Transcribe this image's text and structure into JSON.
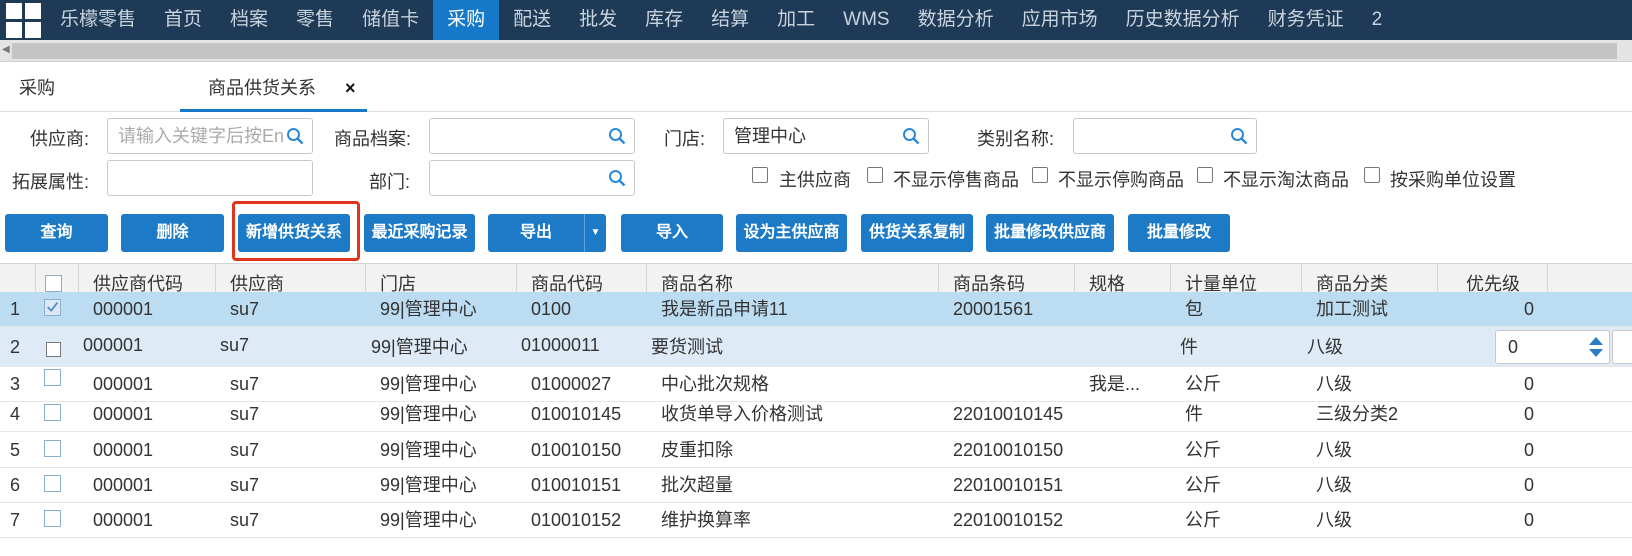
{
  "nav": {
    "brand": "乐檬零售",
    "items": [
      "首页",
      "档案",
      "零售",
      "储值卡",
      "采购",
      "配送",
      "批发",
      "库存",
      "结算",
      "加工",
      "WMS",
      "数据分析",
      "应用市场",
      "历史数据分析",
      "财务凭证",
      "2"
    ],
    "active": "采购"
  },
  "tabs": {
    "tab1": "采购",
    "tab2": "商品供货关系",
    "close": "×"
  },
  "filters": {
    "supplier_label": "供应商:",
    "supplier_placeholder": "请输入关键字后按En",
    "product_label": "商品档案:",
    "product_value": "",
    "store_label": "门店:",
    "store_value": "管理中心",
    "category_label": "类别名称:",
    "category_value": "",
    "ext_label": "拓展属性:",
    "ext_value": "",
    "dept_label": "部门:",
    "dept_value": "",
    "checkboxes": [
      "主供应商",
      "不显示停售商品",
      "不显示停购商品",
      "不显示淘汰商品",
      "按采购单位设置"
    ]
  },
  "buttons": {
    "query": "查询",
    "delete": "删除",
    "add_relation": "新增供货关系",
    "recent_purchase": "最近采购记录",
    "export": "导出",
    "import": "导入",
    "set_main": "设为主供应商",
    "copy_relation": "供货关系复制",
    "batch_supplier": "批量修改供应商",
    "batch_modify": "批量修改"
  },
  "table": {
    "headers": [
      "供应商代码",
      "供应商",
      "门店",
      "商品代码",
      "商品名称",
      "商品条码",
      "规格",
      "计量单位",
      "商品分类",
      "优先级"
    ],
    "rows": [
      {
        "no": "1",
        "code": "000001",
        "supplier": "su7",
        "store": "99|管理中心",
        "pcode": "0100",
        "pname": "我是新品申请11",
        "barcode": "20001561",
        "spec": "",
        "unit": "包",
        "cat": "加工测试",
        "prio": "0"
      },
      {
        "no": "2",
        "code": "000001",
        "supplier": "su7",
        "store": "99|管理中心",
        "pcode": "01000011",
        "pname": "要货测试",
        "barcode": "",
        "spec": "",
        "unit": "件",
        "cat": "八级",
        "prio": "0"
      },
      {
        "no": "3",
        "code": "000001",
        "supplier": "su7",
        "store": "99|管理中心",
        "pcode": "01000027",
        "pname": "中心批次规格",
        "barcode": "",
        "spec": "我是...",
        "unit": "公斤",
        "cat": "八级",
        "prio": "0"
      },
      {
        "no": "4",
        "code": "000001",
        "supplier": "su7",
        "store": "99|管理中心",
        "pcode": "010010145",
        "pname": "收货单导入价格测试",
        "barcode": "22010010145",
        "spec": "",
        "unit": "件",
        "cat": "三级分类2",
        "prio": "0"
      },
      {
        "no": "5",
        "code": "000001",
        "supplier": "su7",
        "store": "99|管理中心",
        "pcode": "010010150",
        "pname": "皮重扣除",
        "barcode": "22010010150",
        "spec": "",
        "unit": "公斤",
        "cat": "八级",
        "prio": "0"
      },
      {
        "no": "6",
        "code": "000001",
        "supplier": "su7",
        "store": "99|管理中心",
        "pcode": "010010151",
        "pname": "批次超量",
        "barcode": "22010010151",
        "spec": "",
        "unit": "公斤",
        "cat": "八级",
        "prio": "0"
      },
      {
        "no": "7",
        "code": "000001",
        "supplier": "su7",
        "store": "99|管理中心",
        "pcode": "010010152",
        "pname": "维护换算率",
        "barcode": "22010010152",
        "spec": "",
        "unit": "公斤",
        "cat": "八级",
        "prio": "0"
      }
    ]
  }
}
